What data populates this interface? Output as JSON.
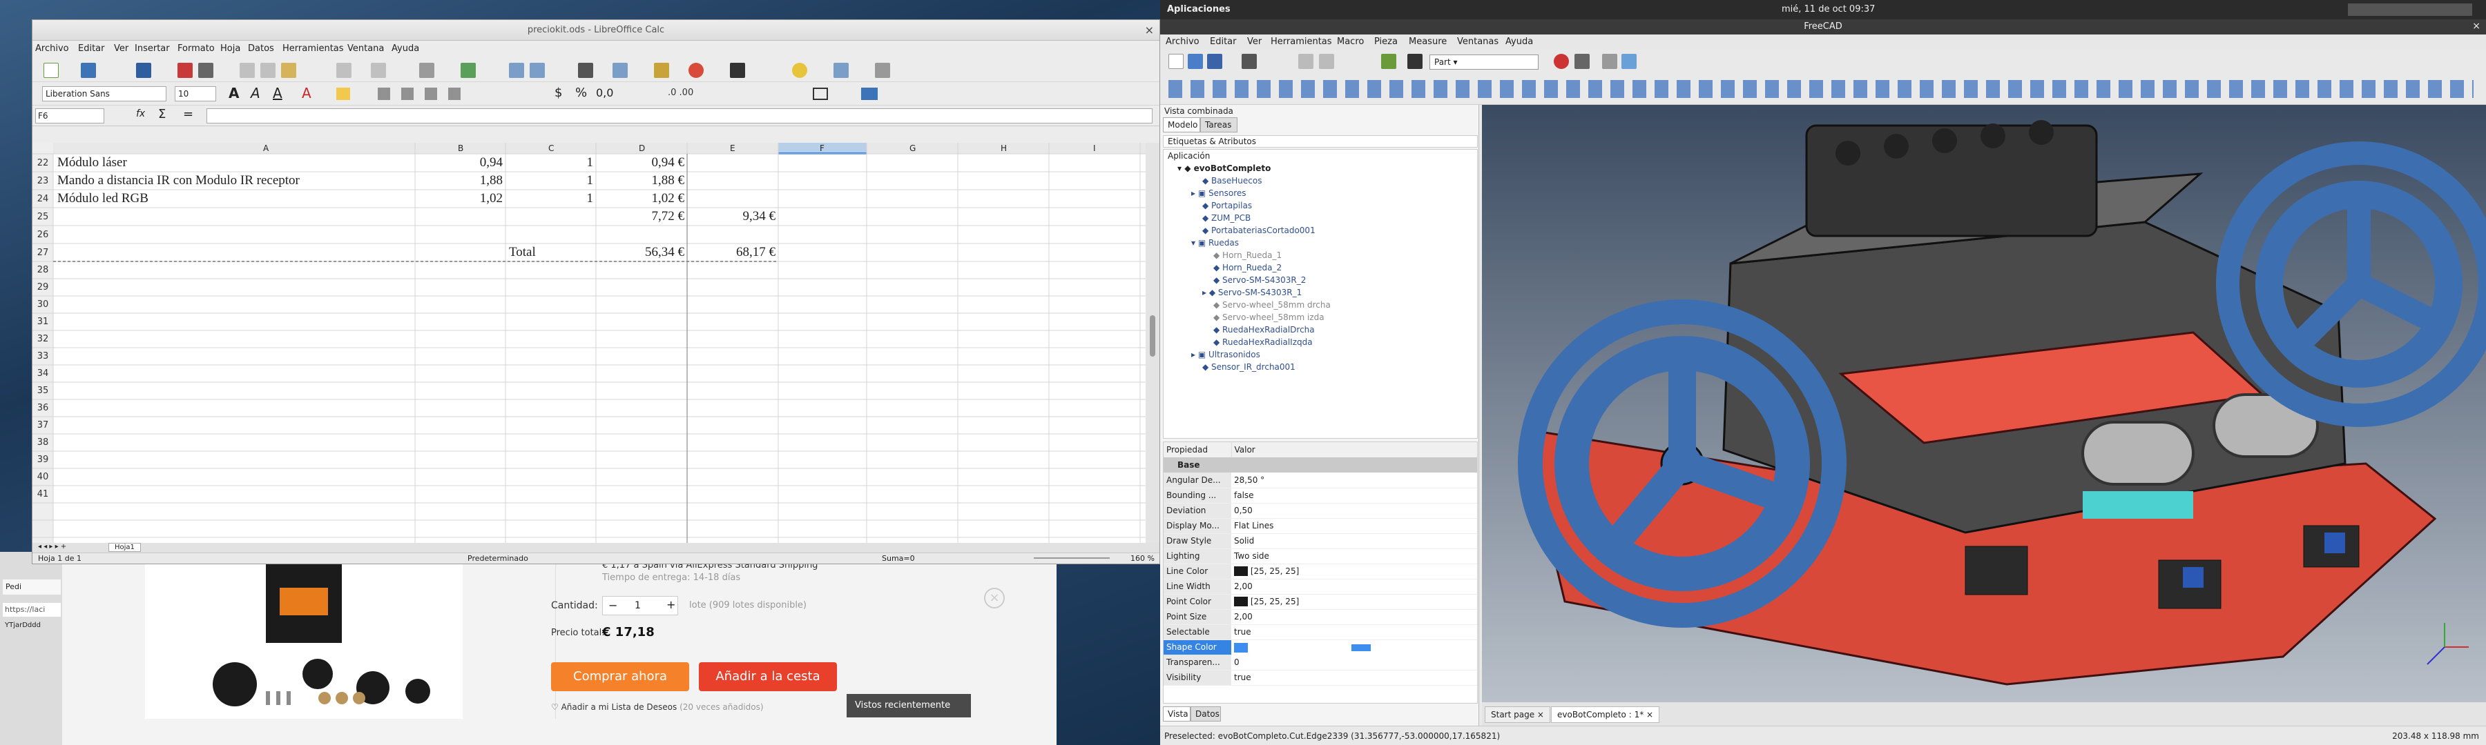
{
  "topbar": {
    "apps": "Aplicaciones",
    "datetime": "mié, 11 de oct  09:37"
  },
  "calc": {
    "title": "preciokit.ods - LibreOffice Calc",
    "menu": [
      "Archivo",
      "Editar",
      "Ver",
      "Insertar",
      "Formato",
      "Hoja",
      "Datos",
      "Herramientas",
      "Ventana",
      "Ayuda"
    ],
    "font_name": "Liberation Sans",
    "font_size": "10",
    "namebox": "F6",
    "columns": [
      "A",
      "B",
      "C",
      "D",
      "E",
      "F",
      "G",
      "H",
      "I"
    ],
    "rows": [
      {
        "n": "22",
        "a": "Módulo láser",
        "b": "0,94",
        "c": "1",
        "d": "0,94 €",
        "e": ""
      },
      {
        "n": "23",
        "a": "Mando a distancia IR con Modulo IR receptor",
        "b": "1,88",
        "c": "1",
        "d": "1,88 €",
        "e": ""
      },
      {
        "n": "24",
        "a": "Módulo led RGB",
        "b": "1,02",
        "c": "1",
        "d": "1,02 €",
        "e": ""
      },
      {
        "n": "25",
        "a": "",
        "b": "",
        "c": "",
        "d": "7,72 €",
        "e": "9,34 €"
      },
      {
        "n": "26",
        "a": "",
        "b": "",
        "c": "",
        "d": "",
        "e": ""
      },
      {
        "n": "27",
        "a": "",
        "b": "",
        "c": "Total",
        "d": "56,34 €",
        "e": "68,17 €"
      }
    ],
    "empty_rows": [
      "28",
      "29",
      "30",
      "31",
      "32",
      "33",
      "34",
      "35",
      "36",
      "37",
      "38",
      "39",
      "40",
      "41"
    ],
    "sheet_tab": "Hoja1",
    "status": {
      "sheet": "Hoja 1 de 1",
      "style": "Predeterminado",
      "sum": "Suma=0",
      "zoom": "160 %"
    }
  },
  "shop": {
    "shipping": "€ 1,17 a Spain via AliExpress Standard Shipping",
    "delivery": "Tiempo de entrega: 14-18 días",
    "qty_label": "Cantidad:",
    "qty": "1",
    "lots": "lote (909 lotes disponible)",
    "price_label": "Precio total:",
    "price": "€ 17,18",
    "buy": "Comprar ahora",
    "cart": "Añadir a la cesta",
    "wishlist": "Añadir a mi Lista de Deseos",
    "wish_count": "(20 veces añadidos)",
    "recent": "Vistos recientemente",
    "tab1": "Pedi",
    "tab2": "YTjarDddd",
    "url": "https://laci"
  },
  "freecad": {
    "title": "FreeCAD",
    "menu": [
      "Archivo",
      "Editar",
      "Ver",
      "Herramientas",
      "Macro",
      "Pieza",
      "Measure",
      "Ventanas",
      "Ayuda"
    ],
    "workbench": "Part",
    "combo_title": "Vista combinada",
    "tabs": [
      "Modelo",
      "Tareas"
    ],
    "labels_header": "Etiquetas & Atributos",
    "app_label": "Aplicación",
    "tree": [
      "evoBotCompleto",
      "BaseHuecos",
      "Sensores",
      "Portapilas",
      "ZUM_PCB",
      "PortabateriasCortado001",
      "Ruedas",
      "Horn_Rueda_1",
      "Horn_Rueda_2",
      "Servo-SM-S4303R_2",
      "Servo-SM-S4303R_1",
      "Servo-wheel_58mm drcha",
      "Servo-wheel_58mm izda",
      "RuedaHexRadialDrcha",
      "RuedaHexRadialIzqda",
      "Ultrasonidos",
      "Sensor_IR_drcha001"
    ],
    "prop_headers": [
      "Propiedad",
      "Valor"
    ],
    "group": "Base",
    "props": [
      {
        "k": "Angular De...",
        "v": "28,50 °"
      },
      {
        "k": "Bounding ...",
        "v": "false"
      },
      {
        "k": "Deviation",
        "v": "0,50"
      },
      {
        "k": "Display Mo...",
        "v": "Flat Lines"
      },
      {
        "k": "Draw Style",
        "v": "Solid"
      },
      {
        "k": "Lighting",
        "v": "Two side"
      },
      {
        "k": "Line Color",
        "v": "[25, 25, 25]"
      },
      {
        "k": "Line Width",
        "v": "2,00"
      },
      {
        "k": "Point Color",
        "v": "[25, 25, 25]"
      },
      {
        "k": "Point Size",
        "v": "2,00"
      },
      {
        "k": "Selectable",
        "v": "true"
      },
      {
        "k": "Shape Color",
        "v": ""
      },
      {
        "k": "Transparen...",
        "v": "0"
      },
      {
        "k": "Visibility",
        "v": "true"
      }
    ],
    "bottom_tabs": [
      "Vista",
      "Datos"
    ],
    "doc_tabs": [
      "Start page",
      "evoBotCompleto : 1*"
    ],
    "status": "Preselected: evoBotCompleto.Cut.Edge2339 (31.356777,-53.000000,17.165821)",
    "dims": "203.48 x 118.98 mm"
  },
  "colors": {
    "blue": "#3d6fb0",
    "red": "#d9493a",
    "dark": "#3a3a3a",
    "orange": "#f5822a",
    "shopred": "#e8402a",
    "select": "#3584e4"
  }
}
